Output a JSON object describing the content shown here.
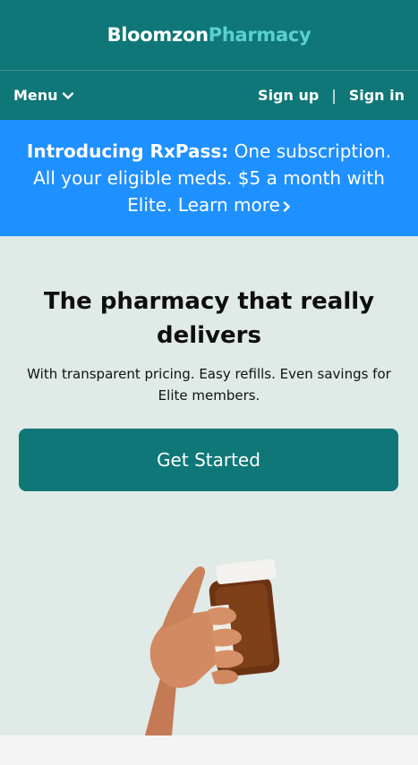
{
  "header": {
    "brand_part1": "Bloomzon",
    "brand_part2": "Pharmacy"
  },
  "nav": {
    "menu_label": "Menu",
    "signup_label": "Sign up",
    "separator": "|",
    "signin_label": "Sign in"
  },
  "promo": {
    "bold": "Introducing RxPass:",
    "text": " One subscription. All your eligible meds. $5 a month with Elite.",
    "link": "Learn more"
  },
  "hero": {
    "title": "The pharmacy that really delivers",
    "subtitle": "With transparent pricing. Easy refills. Even savings for Elite members.",
    "cta_label": "Get Started"
  },
  "colors": {
    "brand_teal": "#0f7777",
    "brand_accent": "#5ad0d0",
    "promo_blue": "#1f90ff",
    "hero_bg": "#e0eae7"
  },
  "icons": {
    "menu": "chevron-down-icon",
    "promo_link": "chevron-right-icon"
  }
}
